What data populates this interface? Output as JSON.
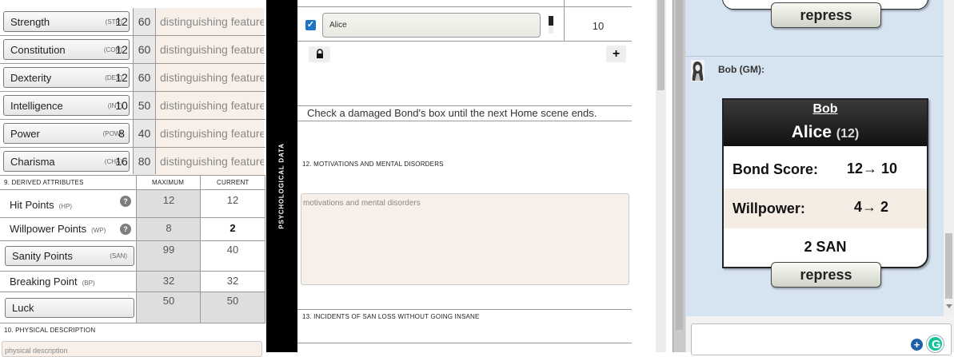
{
  "stats": [
    {
      "label": "Strength",
      "abbr": "(STR)",
      "score": "12",
      "percent": "60",
      "feature": "distinguishing features"
    },
    {
      "label": "Constitution",
      "abbr": "(CON)",
      "score": "12",
      "percent": "60",
      "feature": "distinguishing features"
    },
    {
      "label": "Dexterity",
      "abbr": "(DEX)",
      "score": "12",
      "percent": "60",
      "feature": "distinguishing features"
    },
    {
      "label": "Intelligence",
      "abbr": "(INT)",
      "score": "10",
      "percent": "50",
      "feature": "distinguishing features"
    },
    {
      "label": "Power",
      "abbr": "(POW)",
      "score": "8",
      "percent": "40",
      "feature": "distinguishing features"
    },
    {
      "label": "Charisma",
      "abbr": "(CHA)",
      "score": "16",
      "percent": "80",
      "feature": "distinguishing features"
    }
  ],
  "derived": {
    "section_title": "9. DERIVED ATTRIBUTES",
    "max_header": "MAXIMUM",
    "current_header": "CURRENT",
    "rows": [
      {
        "label": "Hit Points",
        "abbr": "(HP)",
        "max": "12",
        "current": "12"
      },
      {
        "label": "Willpower Points",
        "abbr": "(WP)",
        "max": "8",
        "current": "2"
      },
      {
        "label": "Sanity Points",
        "abbr": "(SAN)",
        "max": "99",
        "current": "40"
      },
      {
        "label": "Breaking Point",
        "abbr": "(BP)",
        "max": "32",
        "current": "32"
      },
      {
        "label": "Luck",
        "abbr": "",
        "max": "50",
        "current": "50"
      }
    ],
    "help_glyph": "?"
  },
  "physical": {
    "section_title": "10. PHYSICAL DESCRIPTION",
    "placeholder": "physical description"
  },
  "vertical_label": "PSYCHOLOGICAL DATA",
  "bonds": {
    "bond_name": "Alice",
    "bond_score": "10",
    "checked": true,
    "lock_icon": "lock-icon",
    "add_glyph": "+",
    "hint": "Check a damaged Bond's box until the next Home scene ends."
  },
  "motivations": {
    "section_title": "12. MOTIVATIONS AND MENTAL DISORDERS",
    "placeholder": "motivations and mental disorders"
  },
  "incidents": {
    "section_title": "13. INCIDENTS OF SAN LOSS WITHOUT GOING INSANE"
  },
  "chat": {
    "top_button": "repress",
    "speaker": "Bob (GM):",
    "card": {
      "link": "Bob",
      "name": "Alice",
      "name_value": "(12)",
      "bond_label": "Bond Score:",
      "bond_value": "12→ 10",
      "wp_label": "Willpower:",
      "wp_value": "4→ 2",
      "san_text": "2 SAN",
      "button": "repress"
    }
  },
  "colors": {
    "chat_bg": "#d6e4f2",
    "card_header": "#1c1c1c",
    "feature_bg": "#f7efe8",
    "textarea_bg": "#f8efe8"
  }
}
